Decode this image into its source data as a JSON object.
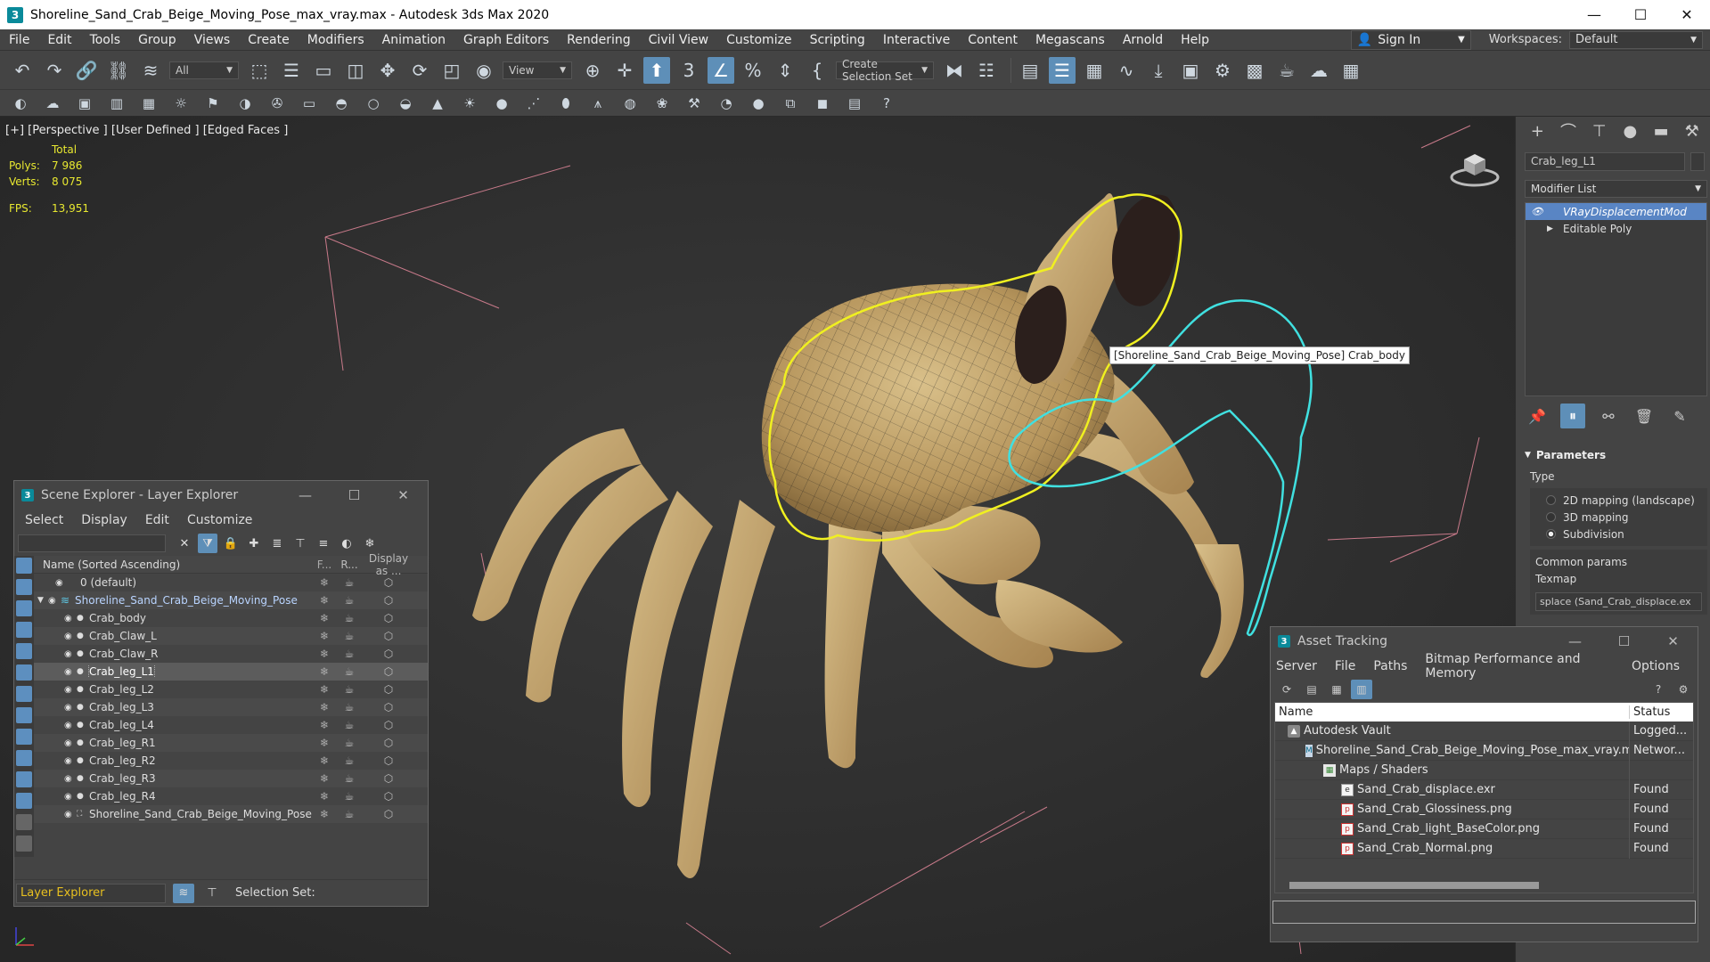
{
  "window": {
    "title": "Shoreline_Sand_Crab_Beige_Moving_Pose_max_vray.max - Autodesk 3ds Max 2020",
    "app_icon": "3"
  },
  "menubar": {
    "items": [
      "File",
      "Edit",
      "Tools",
      "Group",
      "Views",
      "Create",
      "Modifiers",
      "Animation",
      "Graph Editors",
      "Rendering",
      "Civil View",
      "Customize",
      "Scripting",
      "Interactive",
      "Content",
      "Megascans",
      "Arnold",
      "Help"
    ],
    "signin": "Sign In",
    "workspaces_label": "Workspaces:",
    "workspace_value": "Default"
  },
  "toolbar": {
    "filter_value": "All",
    "refcoord_value": "View",
    "selection_set_placeholder": "Create Selection Set"
  },
  "viewport": {
    "label": "[+] [Perspective ] [User Defined ] [Edged Faces ]",
    "stats_header": "Total",
    "polys_label": "Polys:",
    "polys_value": "7 986",
    "verts_label": "Verts:",
    "verts_value": "8 075",
    "fps_label": "FPS:",
    "fps_value": "13,951",
    "tooltip": "[Shoreline_Sand_Crab_Beige_Moving_Pose] Crab_body"
  },
  "command_panel": {
    "object_name": "Crab_leg_L1",
    "modifier_list_label": "Modifier List",
    "stack": [
      {
        "label": "VRayDisplacementMod",
        "selected": true
      },
      {
        "label": "Editable Poly",
        "selected": false
      }
    ],
    "parameters_title": "Parameters",
    "type_label": "Type",
    "type_options": [
      "2D mapping (landscape)",
      "3D mapping",
      "Subdivision"
    ],
    "type_selected": "Subdivision",
    "common_params_label": "Common params",
    "texmap_label": "Texmap",
    "texmap_value": "splace (Sand_Crab_displace.ex"
  },
  "scene_explorer": {
    "title": "Scene Explorer - Layer Explorer",
    "menu": [
      "Select",
      "Display",
      "Edit",
      "Customize"
    ],
    "columns": {
      "name": "Name (Sorted Ascending)",
      "frozen": "F...",
      "render": "R...",
      "display": "Display as ..."
    },
    "rows": [
      {
        "name": "0 (default)",
        "kind": "layer0"
      },
      {
        "name": "Shoreline_Sand_Crab_Beige_Moving_Pose",
        "kind": "layer"
      },
      {
        "name": "Crab_body",
        "kind": "object"
      },
      {
        "name": "Crab_Claw_L",
        "kind": "object"
      },
      {
        "name": "Crab_Claw_R",
        "kind": "object"
      },
      {
        "name": "Crab_leg_L1",
        "kind": "object",
        "selected": true
      },
      {
        "name": "Crab_leg_L2",
        "kind": "object"
      },
      {
        "name": "Crab_leg_L3",
        "kind": "object"
      },
      {
        "name": "Crab_leg_L4",
        "kind": "object"
      },
      {
        "name": "Crab_leg_R1",
        "kind": "object"
      },
      {
        "name": "Crab_leg_R2",
        "kind": "object"
      },
      {
        "name": "Crab_leg_R3",
        "kind": "object"
      },
      {
        "name": "Crab_leg_R4",
        "kind": "object"
      },
      {
        "name": "Shoreline_Sand_Crab_Beige_Moving_Pose",
        "kind": "group"
      }
    ],
    "footer_mode": "Layer Explorer",
    "selection_set_label": "Selection Set:"
  },
  "asset_tracking": {
    "title": "Asset Tracking",
    "menu": [
      "Server",
      "File",
      "Paths",
      "Bitmap Performance and Memory",
      "Options"
    ],
    "columns": {
      "name": "Name",
      "status": "Status"
    },
    "rows": [
      {
        "name": "Autodesk Vault",
        "status": "Logged...",
        "icon": "vault",
        "indent": 0
      },
      {
        "name": "Shoreline_Sand_Crab_Beige_Moving_Pose_max_vray.max",
        "status": "Networ...",
        "icon": "max",
        "indent": 1
      },
      {
        "name": "Maps / Shaders",
        "status": "",
        "icon": "folder",
        "indent": 2
      },
      {
        "name": "Sand_Crab_displace.exr",
        "status": "Found",
        "icon": "exr",
        "indent": 3
      },
      {
        "name": "Sand_Crab_Glossiness.png",
        "status": "Found",
        "icon": "png",
        "indent": 3
      },
      {
        "name": "Sand_Crab_light_BaseColor.png",
        "status": "Found",
        "icon": "png",
        "indent": 3
      },
      {
        "name": "Sand_Crab_Normal.png",
        "status": "Found",
        "icon": "png",
        "indent": 3
      }
    ]
  },
  "colors": {
    "selection_outline": "#f0f020",
    "hover_outline": "#40e0e0",
    "stats_text": "#e8e830",
    "accent_blue": "#5e8fb8"
  }
}
